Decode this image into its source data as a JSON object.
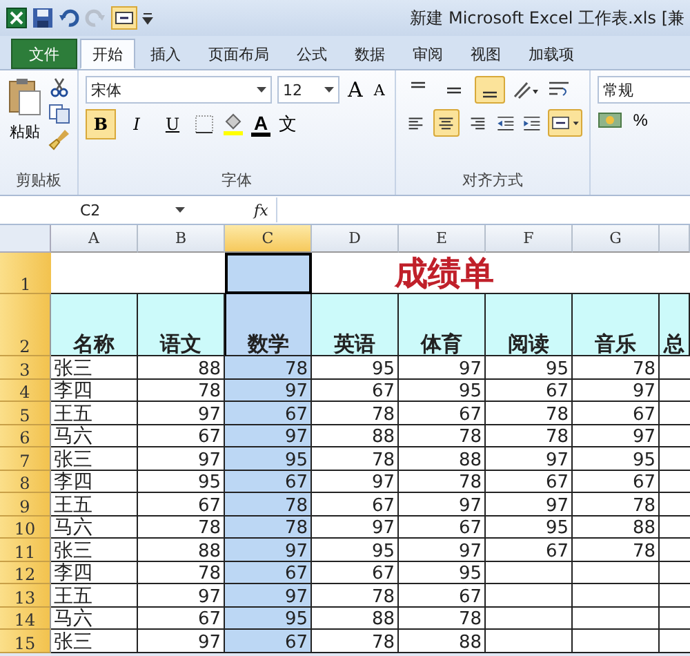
{
  "window": {
    "title": "新建 Microsoft Excel 工作表.xls [兼"
  },
  "tabs": [
    {
      "label": "文件",
      "kind": "file",
      "selected": false
    },
    {
      "label": "开始",
      "kind": "tab",
      "selected": true
    },
    {
      "label": "插入",
      "kind": "tab",
      "selected": false
    },
    {
      "label": "页面布局",
      "kind": "tab",
      "selected": false
    },
    {
      "label": "公式",
      "kind": "tab",
      "selected": false
    },
    {
      "label": "数据",
      "kind": "tab",
      "selected": false
    },
    {
      "label": "审阅",
      "kind": "tab",
      "selected": false
    },
    {
      "label": "视图",
      "kind": "tab",
      "selected": false
    },
    {
      "label": "加载项",
      "kind": "tab",
      "selected": false
    }
  ],
  "ribbon": {
    "paste_label": "粘贴",
    "font_name": "宋体",
    "font_size": "12",
    "grow_font": "A",
    "shrink_font": "A",
    "style_buttons": [
      {
        "label": "B",
        "on": true
      },
      {
        "label": "I",
        "on": false
      },
      {
        "label": "U",
        "on": false
      }
    ],
    "font_color_label": "A",
    "phonetic_label": "文",
    "valign_buttons": [
      {
        "on": false
      },
      {
        "on": false
      },
      {
        "on": true
      }
    ],
    "halign_buttons": [
      {
        "on": false
      },
      {
        "on": true
      },
      {
        "on": false
      }
    ],
    "merge_on": true,
    "number_format": "常规",
    "percent": "%",
    "groups": [
      "剪贴板",
      "字体",
      "对齐方式"
    ]
  },
  "formula_bar": {
    "name_box": "C2",
    "fx": "fx"
  },
  "sheet": {
    "columns": [
      {
        "label": "A",
        "selected": false
      },
      {
        "label": "B",
        "selected": false
      },
      {
        "label": "C",
        "selected": true
      },
      {
        "label": "D",
        "selected": false
      },
      {
        "label": "E",
        "selected": false
      },
      {
        "label": "F",
        "selected": false
      },
      {
        "label": "G",
        "selected": false
      }
    ],
    "title": "成绩单",
    "title_row_number": "1",
    "header_row_number": "2",
    "headers": [
      "名称",
      "语文",
      "数学",
      "英语",
      "体育",
      "阅读",
      "音乐",
      "总"
    ],
    "rows": [
      {
        "number": "3",
        "cells": [
          "张三",
          "88",
          "78",
          "95",
          "97",
          "95",
          "78"
        ]
      },
      {
        "number": "4",
        "cells": [
          "李四",
          "78",
          "97",
          "67",
          "95",
          "67",
          "97"
        ]
      },
      {
        "number": "5",
        "cells": [
          "王五",
          "97",
          "67",
          "78",
          "67",
          "78",
          "67"
        ]
      },
      {
        "number": "6",
        "cells": [
          "马六",
          "67",
          "97",
          "88",
          "78",
          "78",
          "97"
        ]
      },
      {
        "number": "7",
        "cells": [
          "张三",
          "97",
          "95",
          "78",
          "88",
          "97",
          "95"
        ]
      },
      {
        "number": "8",
        "cells": [
          "李四",
          "95",
          "67",
          "97",
          "78",
          "67",
          "67"
        ]
      },
      {
        "number": "9",
        "cells": [
          "王五",
          "67",
          "78",
          "67",
          "97",
          "97",
          "78"
        ]
      },
      {
        "number": "10",
        "cells": [
          "马六",
          "78",
          "78",
          "97",
          "67",
          "95",
          "88"
        ]
      },
      {
        "number": "11",
        "cells": [
          "张三",
          "88",
          "97",
          "95",
          "97",
          "67",
          "78"
        ]
      },
      {
        "number": "12",
        "cells": [
          "李四",
          "78",
          "67",
          "67",
          "95"
        ]
      },
      {
        "number": "13",
        "cells": [
          "王五",
          "97",
          "97",
          "78",
          "67"
        ]
      },
      {
        "number": "14",
        "cells": [
          "马六",
          "67",
          "95",
          "88",
          "78"
        ]
      },
      {
        "number": "15",
        "cells": [
          "张三",
          "97",
          "67",
          "78",
          "88"
        ]
      }
    ]
  }
}
